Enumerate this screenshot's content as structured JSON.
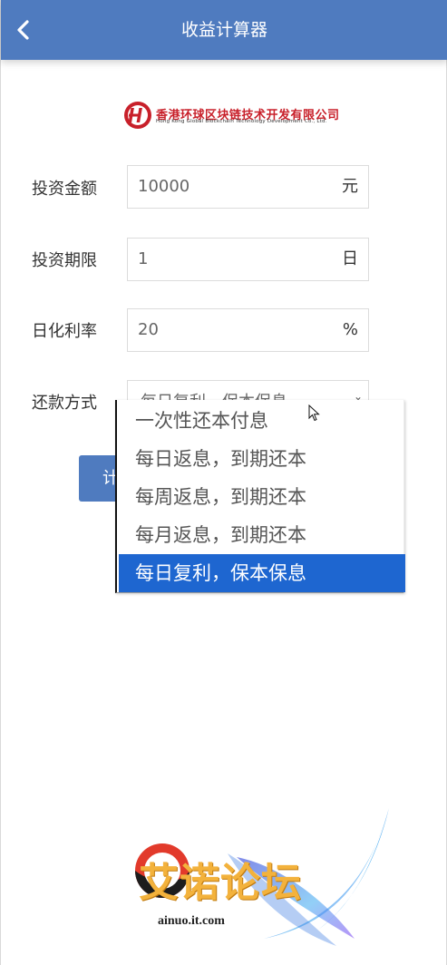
{
  "header": {
    "title": "收益计算器",
    "back_icon": "chevron-left-icon"
  },
  "logo": {
    "name": "香港环球区块链技术开发有限公司",
    "subtitle": "Hong Kong Global Blockchain Technology Development Co., Ltd.",
    "mark": "H"
  },
  "form": {
    "amount": {
      "label": "投资金额",
      "value": "10000",
      "unit": "元"
    },
    "term": {
      "label": "投资期限",
      "value": "1",
      "unit": "日"
    },
    "rate": {
      "label": "日化利率",
      "value": "20",
      "unit": "%"
    },
    "method": {
      "label": "还款方式",
      "value": "每日复利，保本保息"
    }
  },
  "calc_button": {
    "label": "计"
  },
  "dropdown": {
    "options": [
      "一次性还本付息",
      "每日返息，到期还本",
      "每周返息，到期还本",
      "每月返息，到期还本",
      "每日复利，保本保息"
    ],
    "selected_index": 4
  },
  "watermark": {
    "text": "艾诺论坛",
    "url": "ainuo.it.com"
  },
  "colors": {
    "primary": "#4f7bbf",
    "selected": "#1e66d0",
    "logo_red": "#c8202a"
  }
}
